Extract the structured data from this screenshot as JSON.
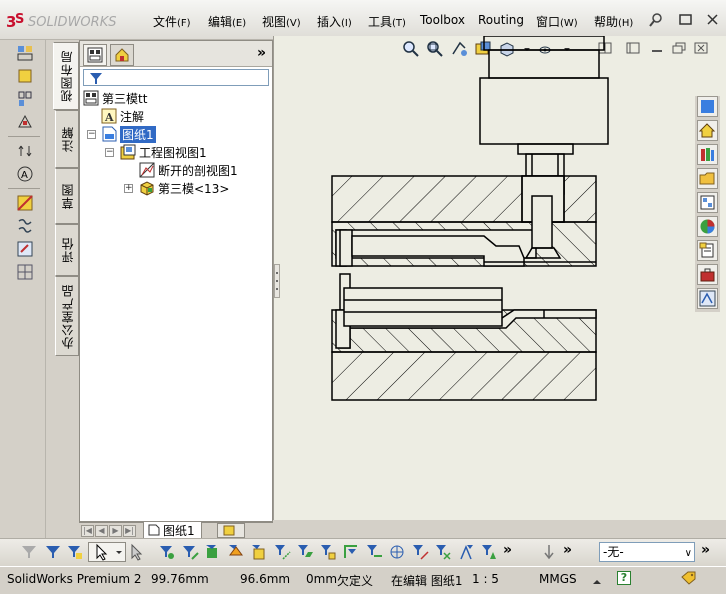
{
  "app": {
    "logo_text": "SOLIDWORKS",
    "colors": {
      "accent": "#316ac5",
      "logo_red": "#c8102e"
    }
  },
  "menu": {
    "items": [
      {
        "label": "文件",
        "acc": "(F)"
      },
      {
        "label": "编辑",
        "acc": "(E)"
      },
      {
        "label": "视图",
        "acc": "(V)"
      },
      {
        "label": "插入",
        "acc": "(I)"
      },
      {
        "label": "工具",
        "acc": "(T)"
      },
      {
        "label": "Toolbox",
        "acc": ""
      },
      {
        "label": "Routing",
        "acc": ""
      },
      {
        "label": "窗口",
        "acc": "(W)"
      },
      {
        "label": "帮助",
        "acc": "(H)"
      }
    ]
  },
  "vertical_tabs": [
    "视图布局",
    "注解",
    "草图",
    "评估",
    "办公室产品"
  ],
  "tree": {
    "items": [
      {
        "label": "第三模tt",
        "icon": "drawing-document-icon"
      },
      {
        "label": "注解",
        "icon": "annotation-icon"
      },
      {
        "label": "图纸1",
        "icon": "sheet-icon"
      },
      {
        "label": "工程图视图1",
        "icon": "drawing-view-icon"
      },
      {
        "label": "断开的剖视图1",
        "icon": "broken-section-view-icon"
      },
      {
        "label": "第三模<13>",
        "icon": "part-icon"
      }
    ]
  },
  "sheet_tabs": {
    "active": "图纸1"
  },
  "layer": {
    "selected": "-无-"
  },
  "status": {
    "product": "SolidWorks Premium 2",
    "x": "99.76mm",
    "y": "96.6mm",
    "z": "0mm",
    "definition": "欠定义",
    "editing": "在编辑 图纸1",
    "scale": "1 : 5",
    "units": "MMGS",
    "help_badge": "?"
  }
}
